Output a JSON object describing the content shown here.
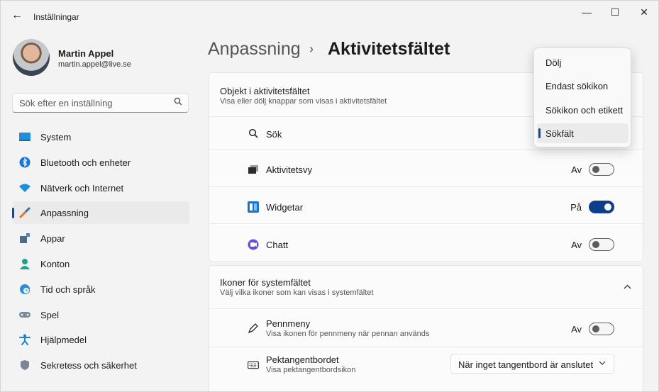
{
  "window": {
    "title": "Inställningar",
    "back_icon": "arrow-left-icon",
    "controls": {
      "minimize": "—",
      "maximize": "☐",
      "close": "✕"
    }
  },
  "profile": {
    "name": "Martin Appel",
    "email": "martin.appel@live.se"
  },
  "search": {
    "placeholder": "Sök efter en inställning",
    "icon": "search-icon"
  },
  "sidebar": {
    "items": [
      {
        "label": "System",
        "icon": "monitor-icon",
        "active": false
      },
      {
        "label": "Bluetooth och enheter",
        "icon": "bluetooth-icon",
        "active": false
      },
      {
        "label": "Nätverk och Internet",
        "icon": "wifi-icon",
        "active": false
      },
      {
        "label": "Anpassning",
        "icon": "brush-icon",
        "active": true
      },
      {
        "label": "Appar",
        "icon": "apps-icon",
        "active": false
      },
      {
        "label": "Konton",
        "icon": "person-icon",
        "active": false
      },
      {
        "label": "Tid och språk",
        "icon": "clock-globe-icon",
        "active": false
      },
      {
        "label": "Spel",
        "icon": "gamepad-icon",
        "active": false
      },
      {
        "label": "Hjälpmedel",
        "icon": "accessibility-icon",
        "active": false
      },
      {
        "label": "Sekretess och säkerhet",
        "icon": "shield-icon",
        "active": false
      }
    ]
  },
  "breadcrumb": {
    "parent": "Anpassning",
    "separator": "›",
    "current": "Aktivitetsfältet"
  },
  "taskbar_items": {
    "title": "Objekt i aktivitetsfältet",
    "subtitle": "Visa eller dölj knappar som visas i aktivitetsfältet",
    "rows": [
      {
        "label": "Sök",
        "icon": "search-icon"
      },
      {
        "label": "Aktivitetsvy",
        "icon": "task-view-icon",
        "state": "Av",
        "on": false
      },
      {
        "label": "Widgetar",
        "icon": "widgets-icon",
        "state": "På",
        "on": true
      },
      {
        "label": "Chatt",
        "icon": "chat-icon",
        "state": "Av",
        "on": false
      }
    ]
  },
  "system_tray": {
    "title": "Ikoner för systemfältet",
    "subtitle": "Välj vilka ikoner som kan visas i systemfältet",
    "rows": [
      {
        "label": "Pennmeny",
        "sublabel": "Visa ikonen för pennmeny när pennan används",
        "icon": "pen-icon",
        "state": "Av",
        "on": false
      },
      {
        "label": "Pektangentbordet",
        "sublabel": "Visa pektangentbordsikon",
        "icon": "keyboard-icon",
        "dropdown": "När inget tangentbord är anslutet"
      }
    ]
  },
  "search_menu": {
    "options": [
      "Dölj",
      "Endast sökikon",
      "Sökikon och etikett",
      "Sökfält"
    ],
    "selected": "Sökfält"
  },
  "colors": {
    "accent": "#0b4aa2",
    "toggle_on": "#0c3e8c",
    "background": "#f3f3f3",
    "card": "#fbfbfb"
  }
}
